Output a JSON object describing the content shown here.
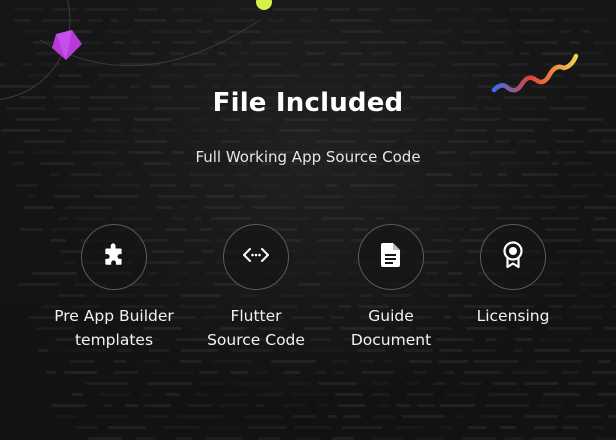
{
  "title": "File Included",
  "subtitle": "Full Working App Source Code",
  "features": [
    {
      "icon": "puzzle-icon",
      "label": "Pre App Builder\ntemplates"
    },
    {
      "icon": "code-brackets-icon",
      "label": "Flutter\nSource Code"
    },
    {
      "icon": "document-icon",
      "label": "Guide\nDocument"
    },
    {
      "icon": "award-badge-icon",
      "label": "Licensing"
    }
  ],
  "colors": {
    "background": "#141414",
    "text": "#ffffff",
    "circle_border": "#5a5a5a",
    "gem": "#b53ad9",
    "dot": "#d6f04a"
  }
}
